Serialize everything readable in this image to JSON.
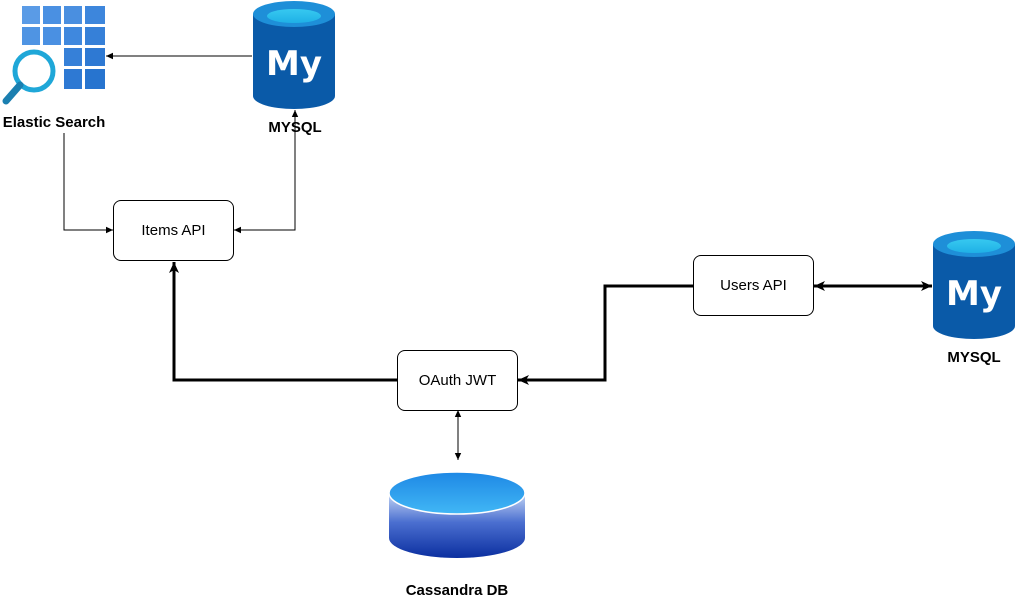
{
  "nodes": {
    "elastic_search": {
      "label": "Elastic Search",
      "icon": "elastic-search-grid-magnifier-icon"
    },
    "mysql_items": {
      "label": "MYSQL",
      "icon": "mysql-database-icon"
    },
    "items_api": {
      "label": "Items API"
    },
    "users_api": {
      "label": "Users API"
    },
    "mysql_users": {
      "label": "MYSQL",
      "icon": "mysql-database-icon"
    },
    "oauth_jwt": {
      "label": "OAuth JWT"
    },
    "cassandra_db": {
      "label": "Cassandra DB",
      "icon": "database-cylinder-icon"
    }
  },
  "mysql_logo_text": "My",
  "edges": [
    {
      "from": "mysql_items",
      "to": "elastic_search",
      "style": "thin"
    },
    {
      "from": "elastic_search",
      "to": "items_api",
      "style": "thin"
    },
    {
      "from": "mysql_items",
      "to": "items_api",
      "style": "thin",
      "bidirectional": true
    },
    {
      "from": "oauth_jwt",
      "to": "items_api",
      "style": "thick"
    },
    {
      "from": "users_api",
      "to": "oauth_jwt",
      "style": "thick"
    },
    {
      "from": "users_api",
      "to": "mysql_users",
      "style": "thick",
      "bidirectional": true
    },
    {
      "from": "oauth_jwt",
      "to": "cassandra_db",
      "style": "thin",
      "bidirectional": true
    }
  ],
  "colors": {
    "mysql_blue": "#0a5aa8",
    "mysql_top": "#1e8fd8",
    "mysql_highlight": "#37c9f0",
    "elastic_tile": "#4a90e2",
    "elastic_magnifier": "#1fa7d8",
    "cassandra_top": "#1e88e5",
    "cassandra_body": "#0b2fa0",
    "line": "#000000"
  }
}
